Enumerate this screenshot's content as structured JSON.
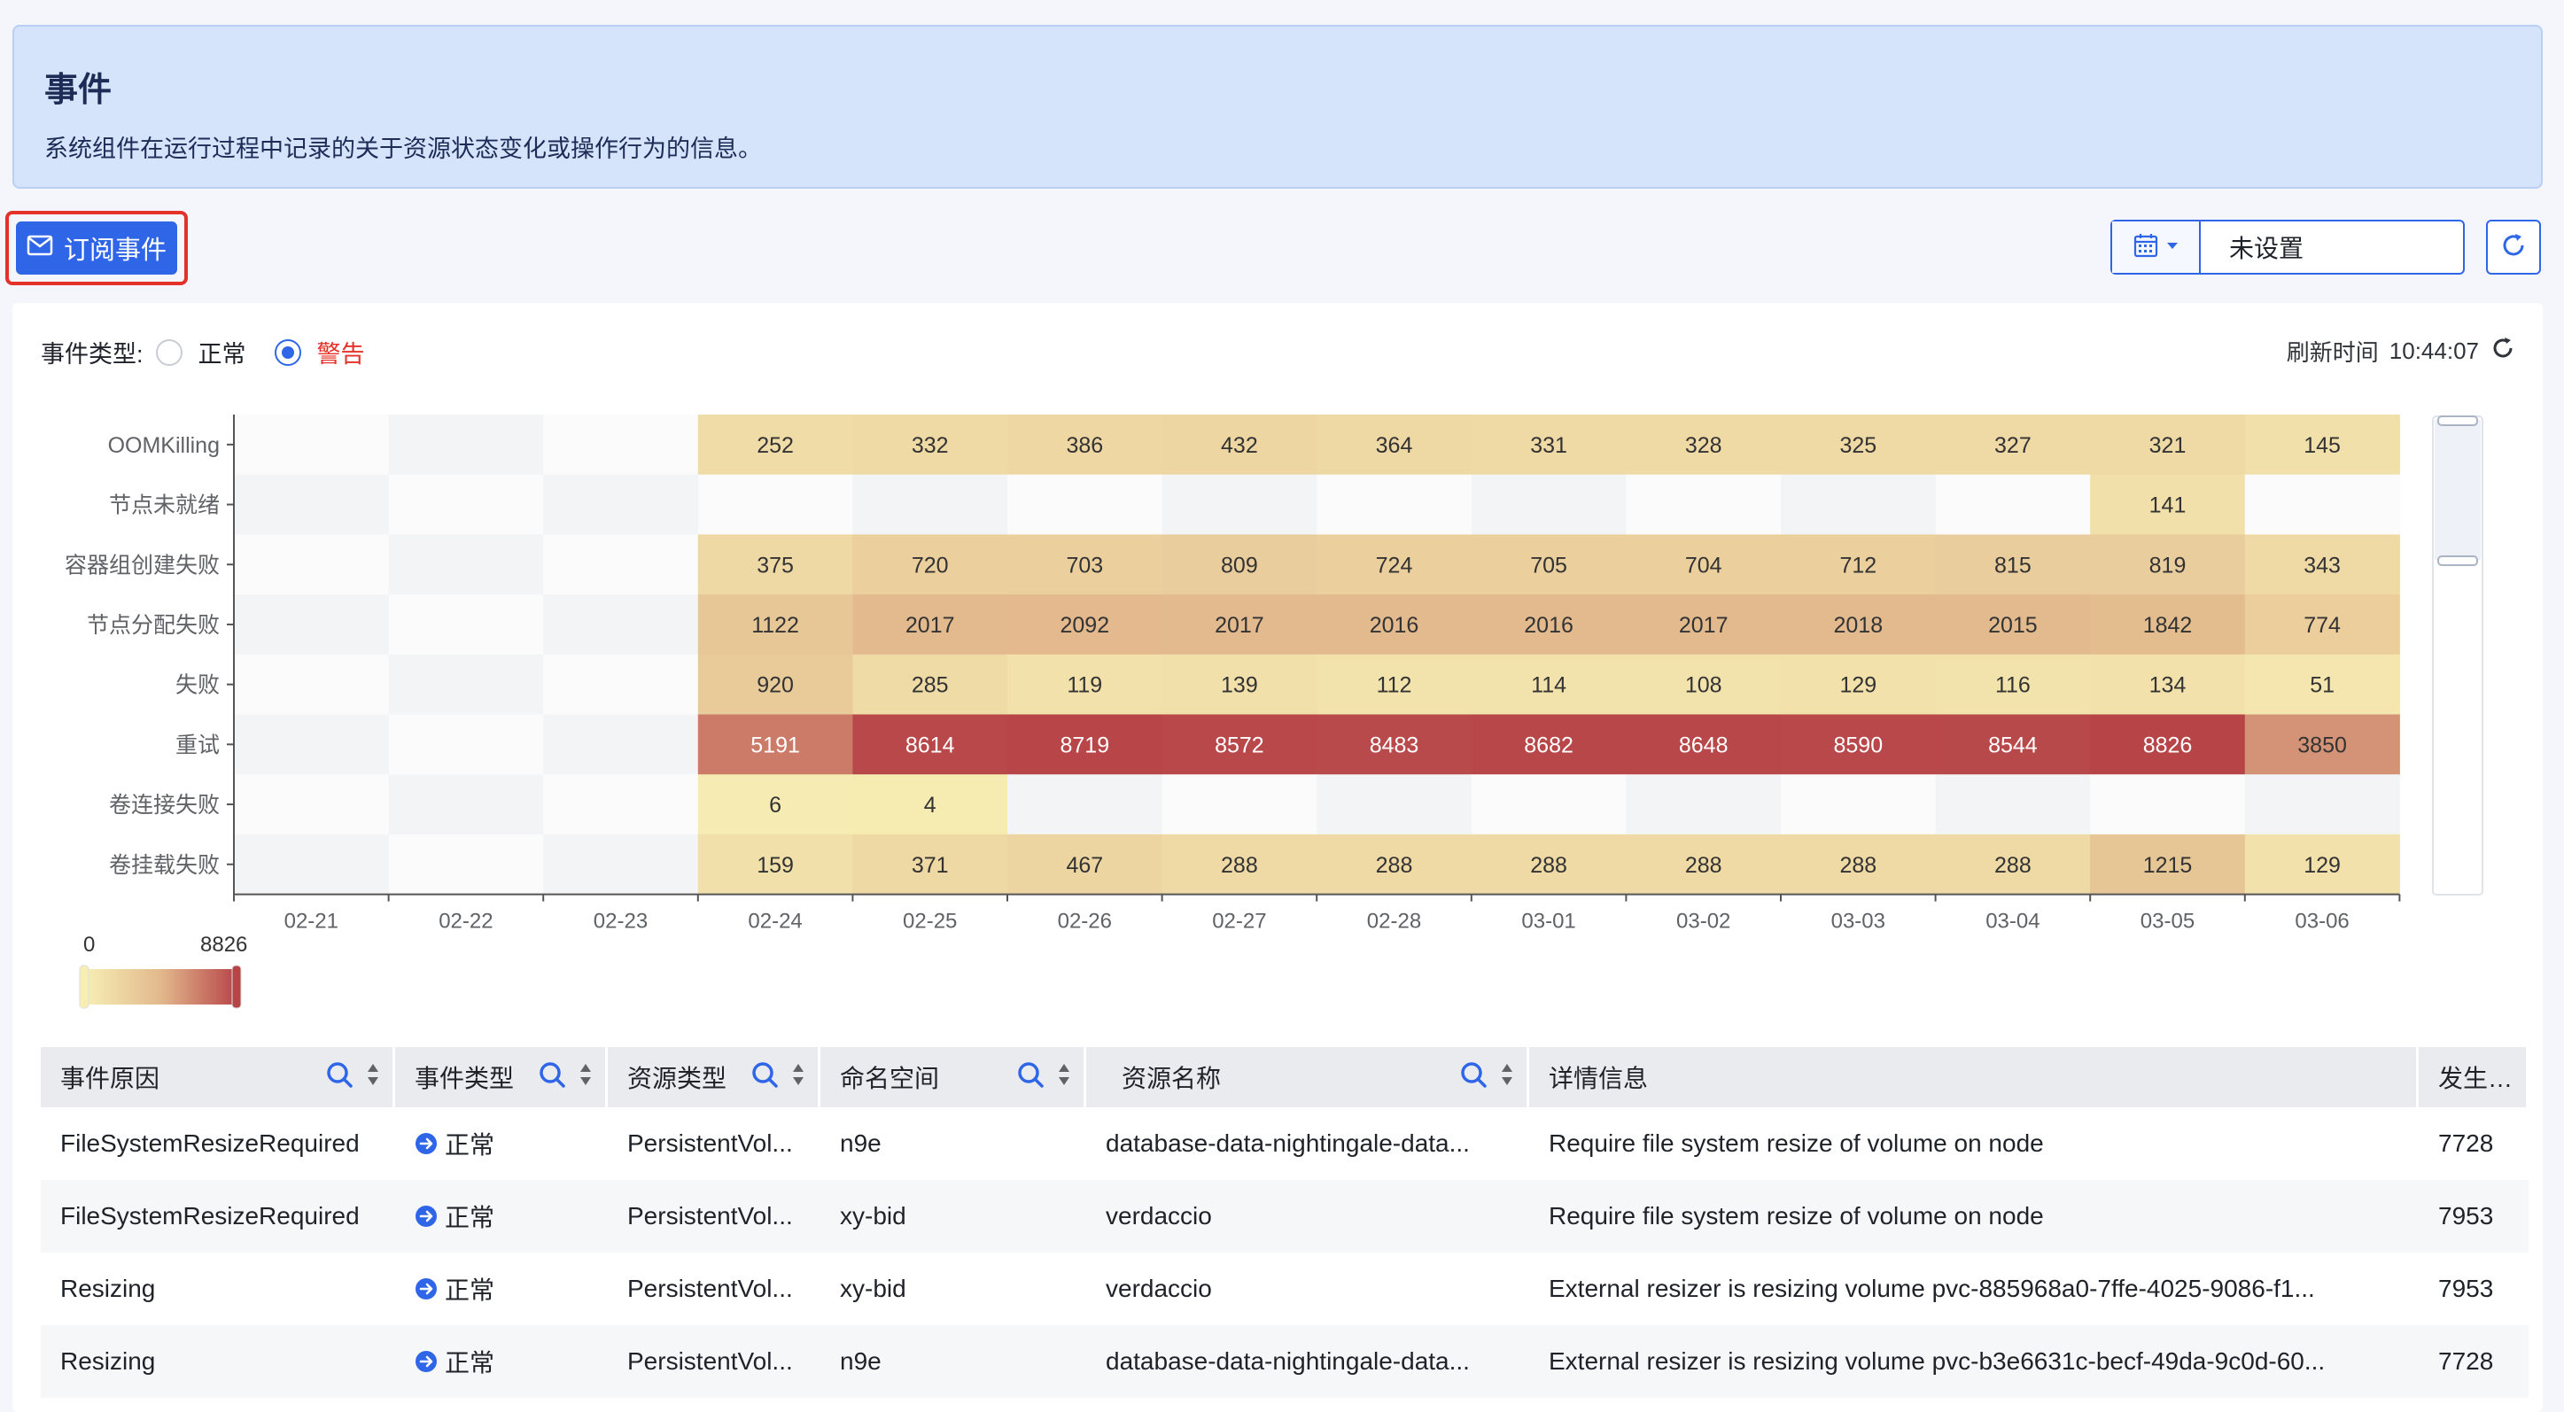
{
  "header": {
    "title": "事件",
    "description": "系统组件在运行过程中记录的关于资源状态变化或操作行为的信息。"
  },
  "toolbar": {
    "subscribe_label": "订阅事件",
    "date_value": "未设置"
  },
  "filter": {
    "label": "事件类型:",
    "options": [
      {
        "label": "正常",
        "checked": false
      },
      {
        "label": "警告",
        "checked": true
      }
    ],
    "refresh_label": "刷新时间",
    "refresh_time": "10:44:07"
  },
  "chart_data": {
    "type": "heatmap",
    "x": [
      "02-21",
      "02-22",
      "02-23",
      "02-24",
      "02-25",
      "02-26",
      "02-27",
      "02-28",
      "03-01",
      "03-02",
      "03-03",
      "03-04",
      "03-05",
      "03-06"
    ],
    "y": [
      "OOMKilling",
      "节点未就绪",
      "容器组创建失败",
      "节点分配失败",
      "失败",
      "重试",
      "卷连接失败",
      "卷挂载失败"
    ],
    "values": [
      [
        null,
        null,
        null,
        252,
        332,
        386,
        432,
        364,
        331,
        328,
        325,
        327,
        321,
        145
      ],
      [
        null,
        null,
        null,
        null,
        null,
        null,
        null,
        null,
        null,
        null,
        null,
        null,
        141,
        null
      ],
      [
        null,
        null,
        null,
        375,
        720,
        703,
        809,
        724,
        705,
        704,
        712,
        815,
        819,
        343
      ],
      [
        null,
        null,
        null,
        1122,
        2017,
        2092,
        2017,
        2016,
        2016,
        2017,
        2018,
        2015,
        1842,
        774
      ],
      [
        null,
        null,
        null,
        920,
        285,
        119,
        139,
        112,
        114,
        108,
        129,
        116,
        134,
        51
      ],
      [
        null,
        null,
        null,
        5191,
        8614,
        8719,
        8572,
        8483,
        8682,
        8648,
        8590,
        8544,
        8826,
        3850
      ],
      [
        null,
        null,
        null,
        6,
        4,
        null,
        null,
        null,
        null,
        null,
        null,
        null,
        null,
        null
      ],
      [
        null,
        null,
        null,
        159,
        371,
        467,
        288,
        288,
        288,
        288,
        288,
        288,
        1215,
        129
      ]
    ],
    "scale": {
      "min": 0,
      "max": 8826,
      "min_label": "0",
      "max_label": "8826"
    },
    "colors": {
      "low": "#f7eeb4",
      "mid": "#e2b88c",
      "high": "#b74548"
    }
  },
  "table": {
    "columns": [
      "事件原因",
      "事件类型",
      "资源类型",
      "命名空间",
      "资源名称",
      "详情信息",
      "发生次数"
    ],
    "rows": [
      [
        "FileSystemResizeRequired",
        "正常",
        "PersistentVol...",
        "n9e",
        "database-data-nightingale-data...",
        "Require file system resize of volume on node",
        "7728"
      ],
      [
        "FileSystemResizeRequired",
        "正常",
        "PersistentVol...",
        "xy-bid",
        "verdaccio",
        "Require file system resize of volume on node",
        "7953"
      ],
      [
        "Resizing",
        "正常",
        "PersistentVol...",
        "xy-bid",
        "verdaccio",
        "External resizer is resizing volume pvc-885968a0-7ffe-4025-9086-f1...",
        "7953"
      ],
      [
        "Resizing",
        "正常",
        "PersistentVol...",
        "n9e",
        "database-data-nightingale-data...",
        "External resizer is resizing volume pvc-b3e6631c-becf-49da-9c0d-60...",
        "7728"
      ]
    ]
  },
  "colors": {
    "primary": "#2f66e8",
    "warning": "#e4322b"
  }
}
